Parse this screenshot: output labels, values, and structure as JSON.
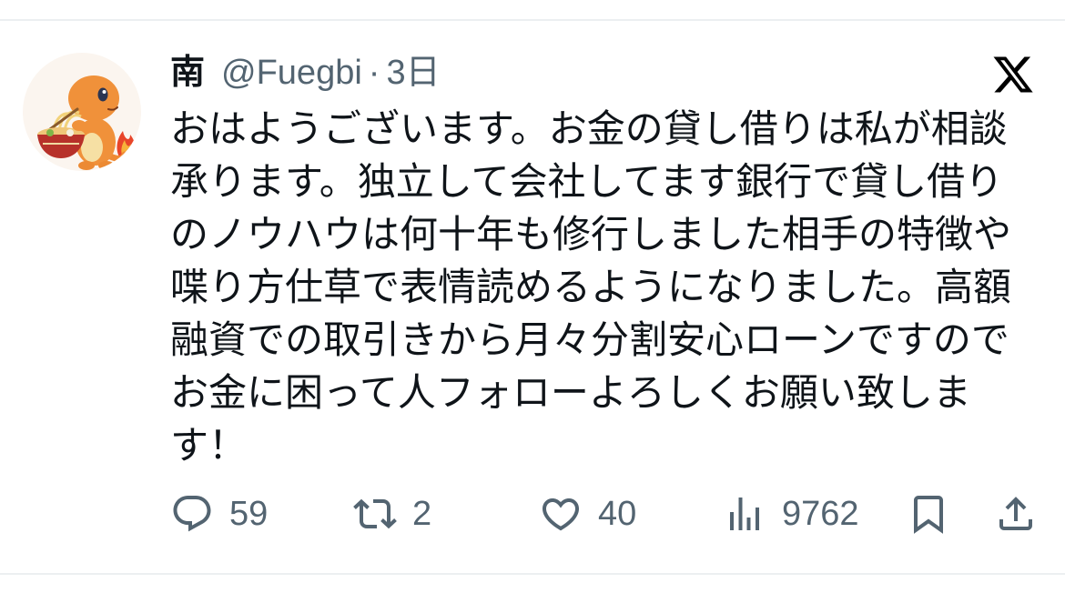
{
  "logo": {
    "icon": "x-logo-icon"
  },
  "post": {
    "author": {
      "display_name": "南",
      "handle": "@Fuegbi",
      "separator": "·",
      "time": "3日"
    },
    "text_lines": [
      "おはようございます。お金の貸し借りは私が相談",
      "承ります。独立して会社してます銀行で貸し借り",
      "のノウハウは何十年も修行しました相手の特徴や",
      "喋り方仕草で表情読めるようになりました。高額",
      "融資での取引きから月々分割安心ローンですので",
      "お金に困って人フォローよろしくお願い致しま",
      "す！"
    ],
    "actions": {
      "reply": {
        "icon": "reply-icon",
        "count": "59"
      },
      "repost": {
        "icon": "repost-icon",
        "count": "2"
      },
      "like": {
        "icon": "heart-icon",
        "count": "40"
      },
      "views": {
        "icon": "views-icon",
        "count": "9762"
      },
      "bookmark": {
        "icon": "bookmark-icon"
      },
      "share": {
        "icon": "share-icon"
      }
    }
  },
  "colors": {
    "background": "#ffffff",
    "text_primary": "#0f1419",
    "text_secondary": "#536471",
    "divider": "#eceff1",
    "logo": "#000000"
  }
}
